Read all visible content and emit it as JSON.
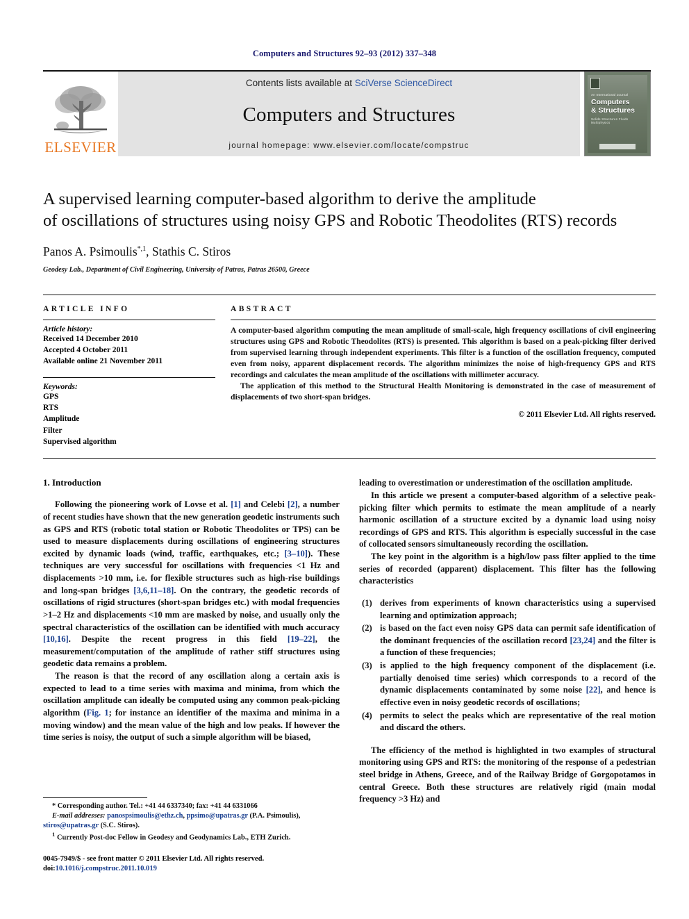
{
  "running_head": "Computers and Structures 92–93 (2012) 337–348",
  "masthead": {
    "publisher": "ELSEVIER",
    "contents_prefix": "Contents lists available at ",
    "contents_link": "SciVerse ScienceDirect",
    "journal_title": "Computers and Structures",
    "homepage": "journal homepage: www.elsevier.com/locate/compstruc",
    "cover": {
      "kicker": "An International Journal",
      "line1": "Computers",
      "line2": "& Structures",
      "subjects": "Solids  Structures  Fluids  Multiphysics"
    }
  },
  "article": {
    "title_line1": "A supervised learning computer-based algorithm to derive the amplitude",
    "title_line2": "of oscillations of structures using noisy GPS and Robotic Theodolites (RTS) records",
    "authors": "Panos A. Psimoulis",
    "authors_sup1": "*,1",
    "authors_rest": ", Stathis C. Stiros",
    "affiliation": "Geodesy Lab., Department of Civil Engineering, University of Patras, Patras 26500, Greece"
  },
  "article_info": {
    "heading": "ARTICLE INFO",
    "history_label": "Article history:",
    "history": [
      "Received 14 December 2010",
      "Accepted 4 October 2011",
      "Available online 21 November 2011"
    ],
    "keywords_label": "Keywords:",
    "keywords": [
      "GPS",
      "RTS",
      "Amplitude",
      "Filter",
      "Supervised algorithm"
    ]
  },
  "abstract": {
    "heading": "ABSTRACT",
    "paragraph1": "A computer-based algorithm computing the mean amplitude of small-scale, high frequency oscillations of civil engineering structures using GPS and Robotic Theodolites (RTS) is presented. This algorithm is based on a peak-picking filter derived from supervised learning through independent experiments. This filter is a function of the oscillation frequency, computed even from noisy, apparent displacement records. The algorithm minimizes the noise of high-frequency GPS and RTS recordings and calculates the mean amplitude of the oscillations with millimeter accuracy.",
    "paragraph2": "The application of this method to the Structural Health Monitoring is demonstrated in the case of measurement of displacements of two short-span bridges.",
    "copyright": "© 2011 Elsevier Ltd. All rights reserved."
  },
  "body": {
    "section_title": "1. Introduction",
    "left": {
      "p1_a": "Following the pioneering work of Lovse et al. ",
      "p1_r1": "[1]",
      "p1_b": " and Celebi ",
      "p1_r2": "[2]",
      "p1_c": ", a number of recent studies have shown that the new generation geodetic instruments such as GPS and RTS (robotic total station or Robotic Theodolites or TPS) can be used to measure displacements during oscillations of engineering structures excited by dynamic loads (wind, traffic, earthquakes, etc.; ",
      "p1_r3": "[3–10]",
      "p1_d": "). These techniques are very successful for oscillations with frequencies <1 Hz and displacements >10 mm, i.e. for flexible structures such as high-rise buildings and long-span bridges ",
      "p1_r4": "[3,6,11–18]",
      "p1_e": ". On the contrary, the geodetic records of oscillations of rigid structures (short-span bridges etc.) with modal frequencies >1–2 Hz and displacements <10 mm are masked by noise, and usually only the spectral characteristics of the oscillation can be identified with much accuracy ",
      "p1_r5": "[10,16]",
      "p1_f": ". Despite the recent progress in this field ",
      "p1_r6": "[19–22]",
      "p1_g": ", the measurement/computation of the amplitude of rather stiff structures using geodetic data remains a problem.",
      "p2_a": "The reason is that the record of any oscillation along a certain axis is expected to lead to a time series with maxima and minima, from which the oscillation amplitude can ideally be computed using any common peak-picking algorithm (",
      "p2_r1": "Fig. 1",
      "p2_b": "; for instance an identifier of the maxima and minima in a moving window) and the mean value of the high and low peaks. If however the time series is noisy, the output of such a simple algorithm will be biased,"
    },
    "right": {
      "p1": "leading to overestimation or underestimation of the oscillation amplitude.",
      "p2": "In this article we present a computer-based algorithm of a selective peak-picking filter which permits to estimate the mean amplitude of a nearly harmonic oscillation of a structure excited by a dynamic load using noisy recordings of GPS and RTS. This algorithm is especially successful in the case of collocated sensors simultaneously recording the oscillation.",
      "p3": "The key point in the algorithm is a high/low pass filter applied to the time series of recorded (apparent) displacement. This filter has the following characteristics",
      "list": [
        {
          "marker": "(1)",
          "text_a": "derives from experiments of known characteristics using a supervised learning and optimization approach;",
          "ref": "",
          "text_b": ""
        },
        {
          "marker": "(2)",
          "text_a": "is based on the fact even noisy GPS data can permit safe identification of the dominant frequencies of the oscillation record ",
          "ref": "[23,24]",
          "text_b": " and the filter is a function of these frequencies;"
        },
        {
          "marker": "(3)",
          "text_a": "is applied to the high frequency component of the displacement (i.e. partially denoised time series) which corresponds to a record of the dynamic displacements contaminated by some noise ",
          "ref": "[22]",
          "text_b": ", and hence is effective even in noisy geodetic records of oscillations;"
        },
        {
          "marker": "(4)",
          "text_a": "permits to select the peaks which are representative of the real motion and discard the others.",
          "ref": "",
          "text_b": ""
        }
      ],
      "p4": "The efficiency of the method is highlighted in two examples of structural monitoring using GPS and RTS: the monitoring of the response of a pedestrian steel bridge in Athens, Greece, and of the Railway Bridge of Gorgopotamos in central Greece. Both these structures are relatively rigid (main modal frequency >3 Hz) and"
    }
  },
  "footnotes": {
    "corresponding": "* Corresponding author. Tel.: +41 44 6337340; fax: +41 44 6331066",
    "email_label": "E-mail addresses:",
    "email1": "panospsimoulis@ethz.ch",
    "email_sep": ", ",
    "email2": "ppsimo@upatras.gr",
    "email_paren1": " (P.A. Psimoulis), ",
    "email3": "stiros@upatras.gr",
    "email_paren2": " (S.C. Stiros).",
    "note1_marker": "1",
    "note1": "Currently Post-doc Fellow in Geodesy and Geodynamics Lab., ETH Zurich.",
    "issn_line": "0045-7949/$ - see front matter © 2011 Elsevier Ltd. All rights reserved.",
    "doi_label": "doi:",
    "doi": "10.1016/j.compstruc.2011.10.019"
  },
  "colors": {
    "running_head": "#1a1a6e",
    "link": "#1a3f8f",
    "elsevier_orange": "#E87722",
    "band_gray": "#e3e3e3"
  }
}
